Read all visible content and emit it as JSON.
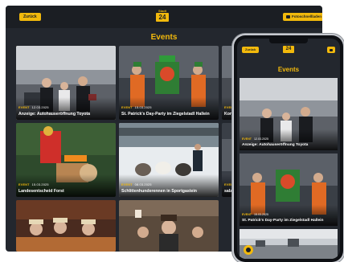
{
  "colors": {
    "accent": "#f2b90c",
    "background": "#23272e",
    "topbar": "#1b1e23"
  },
  "header": {
    "back_label": "Zurück",
    "logo_small": "Stadt",
    "logo_big": "24",
    "photo_button_label": "Fotoschnellladen",
    "photo_icon": "camera-icon"
  },
  "section_title": "Events",
  "events": [
    {
      "tag": "EVENT",
      "date": "12.03.2025",
      "title": "Anzeige: Autohauseröffnung Toyota"
    },
    {
      "tag": "EVENT",
      "date": "15.03.2025",
      "title": "St. Patrick's Day-Party im Ziegelstadl Hallein"
    },
    {
      "tag": "EVENT",
      "date": "",
      "title": "Konz"
    },
    {
      "tag": "EVENT",
      "date": "15.03.2025",
      "title": "Landesentscheid Forst"
    },
    {
      "tag": "EVENT",
      "date": "08.03.2025",
      "title": "Schlittenhunderennen in Sportgastein"
    },
    {
      "tag": "EVENT",
      "date": "",
      "title": "salzb"
    }
  ],
  "phone": {
    "back_label": "Zurück",
    "logo_big": "24",
    "section_title": "Events",
    "events": [
      {
        "tag": "EVENT",
        "date": "12.03.2025",
        "title": "Anzeige: Autohauseröffnung Toyota"
      },
      {
        "tag": "EVENT",
        "date": "15.03.2025",
        "title": "St. Patrick's Day-Party im Ziegelstadl Hallein"
      }
    ]
  }
}
